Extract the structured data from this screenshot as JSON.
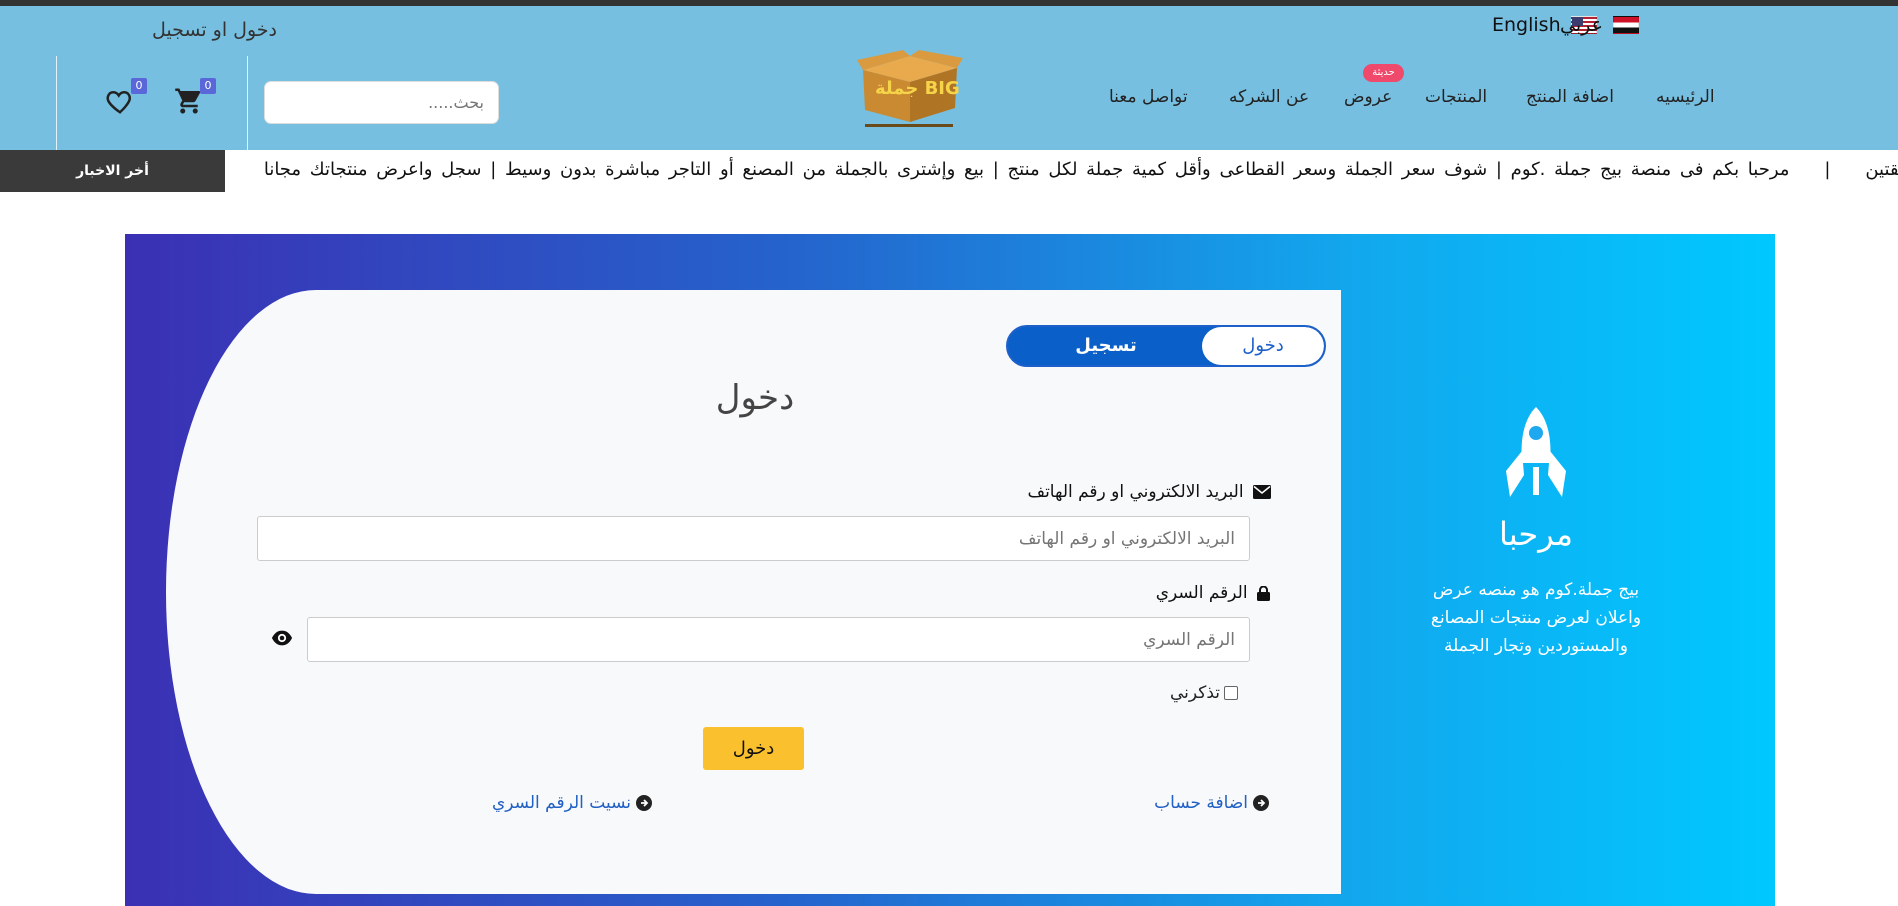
{
  "header": {
    "lang_en": "English",
    "lang_ar": "عربي",
    "login_register": "دخول او تسجيل",
    "nav": [
      "الرئيسيه",
      "اضافة المنتج",
      "المنتجات",
      "عروض",
      "عن الشركه",
      "تواصل معنا"
    ],
    "new_badge": "حديثة",
    "logo_alt_text": "جملة BIG",
    "search_placeholder": "بحث.....",
    "cart_count": "0",
    "wishlist_count": "0"
  },
  "ticker": {
    "text": "مرحبا بكم فى منصة بيج جملة .كوم   |   شوف سعر الجملة وسعر القطاعى وأقل كمية جملة لكل منتج   |   بيع وإشترى بالجملة من المصنع أو التاجر مباشرة بدون وسيط   |   سجل واعرض منتجاتك مجانا",
    "left_end": "يقتين",
    "news_label": "أخر الاخبار"
  },
  "login_form": {
    "tab_login": "دخول",
    "tab_register": "تسجيل",
    "title": "دخول",
    "email_label": "البريد الالكتروني او رقم الهاتف",
    "email_placeholder": "البريد الالكتروني او رقم الهاتف",
    "password_label": "الرقم السري",
    "password_placeholder": "الرقم السري",
    "remember_label": "تذكرني",
    "submit_label": "دخول",
    "add_account": "اضافة حساب",
    "forgot_password": "نسيت الرقم السري"
  },
  "welcome": {
    "title": "مرحبا",
    "text": "بيج جملة.كوم هو منصه عرض واعلان لعرض منتجات المصانع والمستوردين وتجار الجملة"
  },
  "colors": {
    "header_bg": "#76bfe1",
    "accent_blue": "#1e60c9",
    "submit_yellow": "#fbc02d",
    "badge_pink": "#ef4a6b"
  }
}
